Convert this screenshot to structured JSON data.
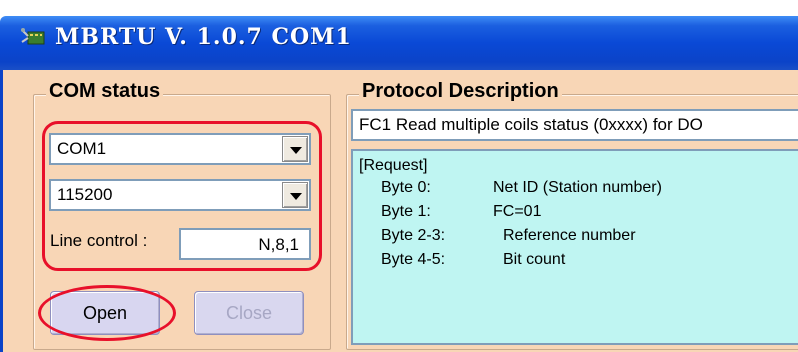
{
  "window": {
    "title": "MBRTU  V. 1.0.7  COM1",
    "icon": "app-plug-icon"
  },
  "com_status": {
    "title": "COM status",
    "port_select": {
      "value": "COM1"
    },
    "baud_select": {
      "value": "115200"
    },
    "line_control_label": "Line control :",
    "line_control_value": "N,8,1",
    "open_label": "Open",
    "close_label": "Close"
  },
  "protocol": {
    "title": "Protocol Description",
    "function_text": "FC1  Read multiple coils status (0xxxx)  for DO",
    "request_header": "[Request]",
    "rows": [
      {
        "byte": "Byte 0:",
        "desc": "Net ID (Station number)"
      },
      {
        "byte": "Byte 1:",
        "desc": "FC=01"
      },
      {
        "byte": "Byte 2-3:",
        "desc": "Reference number"
      },
      {
        "byte": "Byte 4-5:",
        "desc": "Bit count"
      }
    ]
  },
  "colors": {
    "title_bar": "#0b43c8",
    "client_bg": "#f8d6b6",
    "description_bg": "#bff5f2",
    "highlight_ring": "#e8102a"
  }
}
